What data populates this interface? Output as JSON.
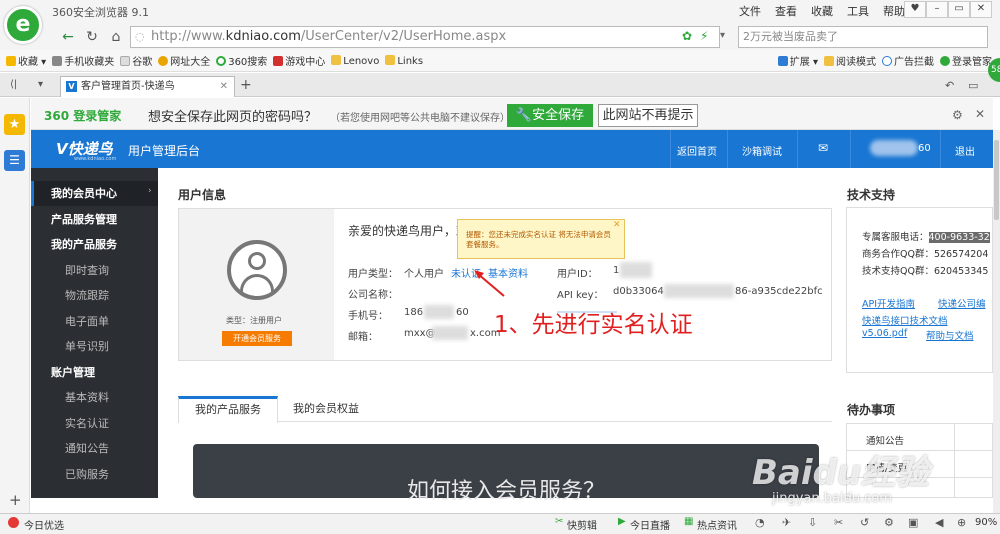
{
  "browser": {
    "title": "360安全浏览器 9.1",
    "menus": [
      "文件",
      "查看",
      "收藏",
      "工具",
      "帮助"
    ],
    "url_prefix": "http://www.",
    "url_domain": "kdniao.com",
    "url_path": "/UserCenter/v2/UserHome.aspx",
    "search_text": "2万元被当废品卖了",
    "bookmarks": [
      "收藏",
      "手机收藏夹",
      "谷歌",
      "网址大全",
      "360搜索",
      "游戏中心",
      "Lenovo",
      "Links"
    ],
    "bookmark_right": [
      "扩展",
      "阅读模式",
      "广告拦截",
      "登录管家"
    ],
    "tab_title": "客户管理首页-快递鸟",
    "zoom": "90%",
    "status_left": "今日优选",
    "status_items": [
      "快剪辑",
      "今日直播",
      "热点资讯"
    ],
    "colors": {
      "accent": "#2fa93a",
      "site_blue": "#1976d2"
    }
  },
  "pwbanner": {
    "brand": "360 登录管家",
    "question": "想安全保存此网页的密码吗？",
    "note": "（若您使用网吧等公共电脑不建议保存）",
    "save_btn": "安全保存",
    "never_btn": "此网站不再提示"
  },
  "site": {
    "logo": "V快递鸟",
    "logo_sub": "www.kdniao.com",
    "header_title": "用户管理后台",
    "header_links": [
      "返回首页",
      "沙箱调试"
    ],
    "user_suffix": "60",
    "logout": "退出"
  },
  "nav": [
    {
      "label": "我的会员中心",
      "type": "active"
    },
    {
      "label": "产品服务管理",
      "type": "head"
    },
    {
      "label": "我的产品服务",
      "type": "head"
    },
    {
      "label": "即时查询",
      "type": "sub"
    },
    {
      "label": "物流跟踪",
      "type": "sub"
    },
    {
      "label": "电子面单",
      "type": "sub"
    },
    {
      "label": "单号识别",
      "type": "sub"
    },
    {
      "label": "账户管理",
      "type": "head"
    },
    {
      "label": "基本资料",
      "type": "sub"
    },
    {
      "label": "实名认证",
      "type": "sub"
    },
    {
      "label": "通知公告",
      "type": "sub"
    },
    {
      "label": "已购服务",
      "type": "sub"
    }
  ],
  "userinfo": {
    "section_title": "用户信息",
    "account_type": "类型：注册用户",
    "open_btn": "开通会员服务",
    "greeting": "亲爱的快递鸟用户，欢",
    "user_type_label": "用户类型：",
    "user_type_value": "个人用户",
    "unverified": "未认证",
    "basic_info": "基本资料",
    "company_label": "公司名称：",
    "phone_label": "手机号：",
    "phone_value": "186",
    "phone_tail": "60",
    "email_label": "邮箱：",
    "email_value": "mxx@",
    "email_tail": "x.com",
    "userid_label": "用户ID：",
    "userid_value": "1",
    "apikey_label": "API key：",
    "apikey_start": "d0b33064",
    "apikey_end": "86-a935cde22bfc",
    "tooltip": "提醒：您还未完成实名认证 将无法申请会员套餐服务。",
    "annotation": "1、先进行实名认证"
  },
  "tabs": [
    "我的产品服务",
    "我的会员权益"
  ],
  "panel_text": "如何接入会员服务？",
  "support": {
    "title": "技术支持",
    "lines": [
      {
        "label": "专属客服电话：",
        "value": "400-9633-32"
      },
      {
        "label": "商务合作QQ群：",
        "value": "526574204"
      },
      {
        "label": "技术支持QQ群：",
        "value": "620453345"
      }
    ],
    "links": [
      "API开发指南",
      "快递公司编",
      "快递鸟接口技术文档",
      "v5.06.pdf",
      "帮助与文档"
    ]
  },
  "todo": {
    "title": "待办事项",
    "items": [
      "通知公告",
      "申请/变更"
    ]
  },
  "watermark": {
    "brand": "Baidu经验",
    "url": "jingyan.baidu.com"
  }
}
